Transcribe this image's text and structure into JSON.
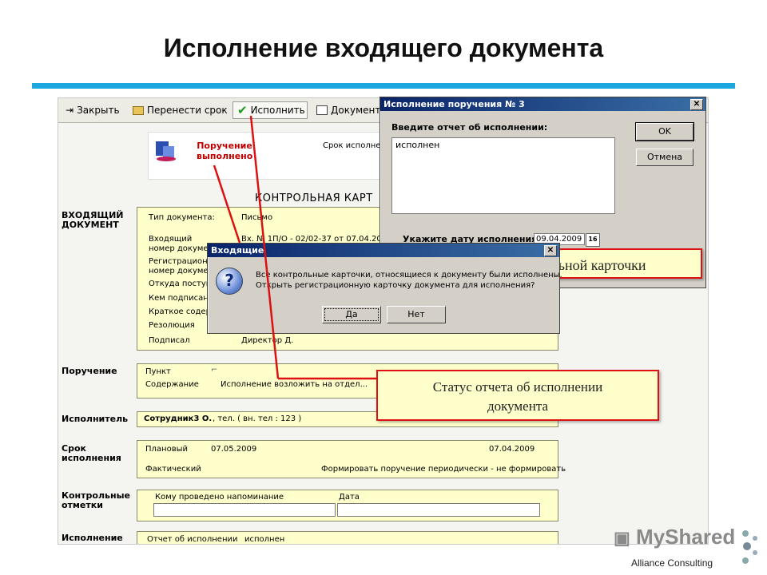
{
  "slide": {
    "title": "Исполнение входящего документа",
    "rule_color": "#1aa7e0",
    "footer": "Alliance Consulting",
    "watermark": "MyShared"
  },
  "toolbar": {
    "close_label": "Закрыть",
    "reschedule_label": "Перенести срок",
    "execute_label": "Исполнить",
    "document_label": "Документ"
  },
  "card": {
    "status": "Поручение выполнено",
    "deadline_label": "Срок исполнен",
    "heading": "КОНТРОЛЬНАЯ КАРТ",
    "section_incoming": "ВХОДЯЩИЙ ДОКУМЕНТ",
    "doc_type_label": "Тип документа:",
    "doc_type_value": "Письмо",
    "incoming_label_1": "Входящий",
    "incoming_label_2": "номер докумен",
    "incoming_value": "Вх. № 1П/О - 02/02-37 от 07.04.200",
    "reg_label_1": "Регистрацион",
    "reg_label_2": "номер докумен",
    "from_label": "Откуда поступ",
    "signed_by_label": "Кем подписан",
    "summary_label": "Краткое содер",
    "resolution_label": "Резолюция",
    "signatory_label": "Подписал",
    "signatory_value": "Директор Д.",
    "section_order": "Поручение",
    "point_label": "Пункт",
    "content_label": "Содержание",
    "content_value": "Исполнение возложить на отдел...",
    "section_executor": "Исполнитель",
    "executor_value": "Сотрудник3 О.",
    "executor_phone": ", тел. ( вн. тел : 123 )",
    "section_deadline_1": "Срок",
    "section_deadline_2": "исполнения",
    "planned_label": "Плановый",
    "planned_value": "07.05.2009",
    "planned_value_2": "07.04.2009",
    "actual_label": "Фактический",
    "periodic_label": "Формировать поручение периодически - не формировать",
    "section_control_1": "Контрольные",
    "section_control_2": "отметки",
    "reminder_label": "Кому проведено напоминание",
    "date_label": "Дата",
    "section_execution": "Исполнение",
    "report_label": "Отчет об исполнении",
    "report_value": "исполнен"
  },
  "dialog_execution": {
    "title": "Исполнение поручения № 3",
    "prompt": "Введите отчет об исполнении:",
    "report_text": "исполнен",
    "date_label": "Укажите дату исполнения",
    "date_value": "09.04.2009",
    "calendar_glyph": "16",
    "ok_label": "OK",
    "cancel_label": "Отмена"
  },
  "dialog_confirm": {
    "title": "Входящие",
    "message_1": "Все контрольные карточки, относящиеся к документу были исполнены.",
    "message_2": "Открыть регистрационную карточку документа для исполнения?",
    "yes_label": "Да",
    "no_label": "Нет",
    "icon_glyph": "?"
  },
  "callouts": {
    "card_callout": "ольной карточки",
    "status_callout_1": "Статус отчета об исполнении",
    "status_callout_2": "документа"
  },
  "colors": {
    "accent_red": "#d11",
    "card_yellow": "#ffffcc",
    "dialog_gray": "#d4d0c8",
    "titlebar_blue": "#0a246a"
  }
}
